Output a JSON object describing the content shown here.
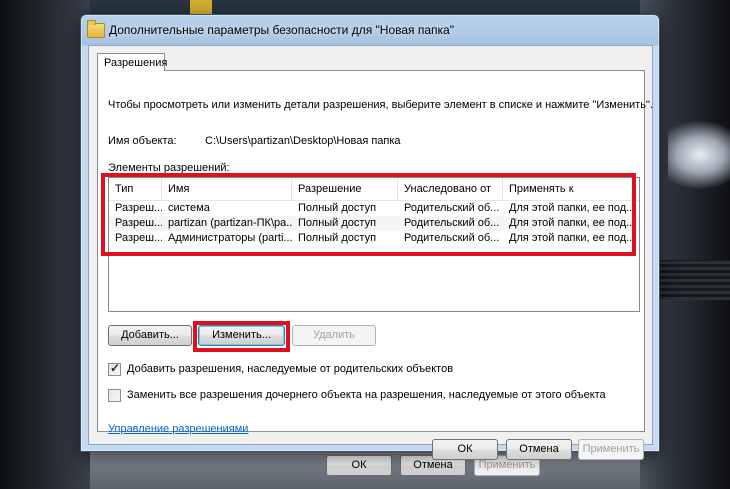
{
  "window": {
    "title": "Дополнительные параметры безопасности  для \"Новая папка\""
  },
  "tab": {
    "label": "Разрешения"
  },
  "description": "Чтобы просмотреть или изменить детали разрешения, выберите элемент в списке и нажмите \"Изменить\".",
  "object": {
    "label": "Имя объекта:",
    "value": "C:\\Users\\partizan\\Desktop\\Новая папка"
  },
  "entries_label": "Элементы разрешений:",
  "table": {
    "columns": [
      "Тип",
      "Имя",
      "Разрешение",
      "Унаследовано от",
      "Применять к"
    ],
    "rows": [
      [
        "Разреш...",
        "система",
        "Полный доступ",
        "Родительский об...",
        "Для этой папки, ее под..."
      ],
      [
        "Разреш...",
        "partizan (partizan-ПК\\pa...",
        "Полный доступ",
        "Родительский об...",
        "Для этой папки, ее под..."
      ],
      [
        "Разреш...",
        "Администраторы (parti...",
        "Полный доступ",
        "Родительский об...",
        "Для этой папки, ее под..."
      ]
    ]
  },
  "buttons": {
    "add": "Добавить...",
    "edit": "Изменить...",
    "delete": "Удалить",
    "ok": "ОК",
    "cancel": "Отмена",
    "apply": "Применить"
  },
  "checkboxes": {
    "inherit": {
      "label": "Добавить разрешения, наследуемые от родительских объектов",
      "checked": true
    },
    "replace": {
      "label": "Заменить все разрешения дочернего объекта на разрешения, наследуемые от этого объекта",
      "checked": false
    }
  },
  "link": "Управление разрешениями",
  "background_dialog": {
    "ok": "ОК",
    "cancel": "Отмена",
    "apply": "Применить"
  },
  "colors": {
    "highlight_frame": "#e0101e",
    "link": "#0066cc",
    "titlebar": "#b9d1ea"
  }
}
